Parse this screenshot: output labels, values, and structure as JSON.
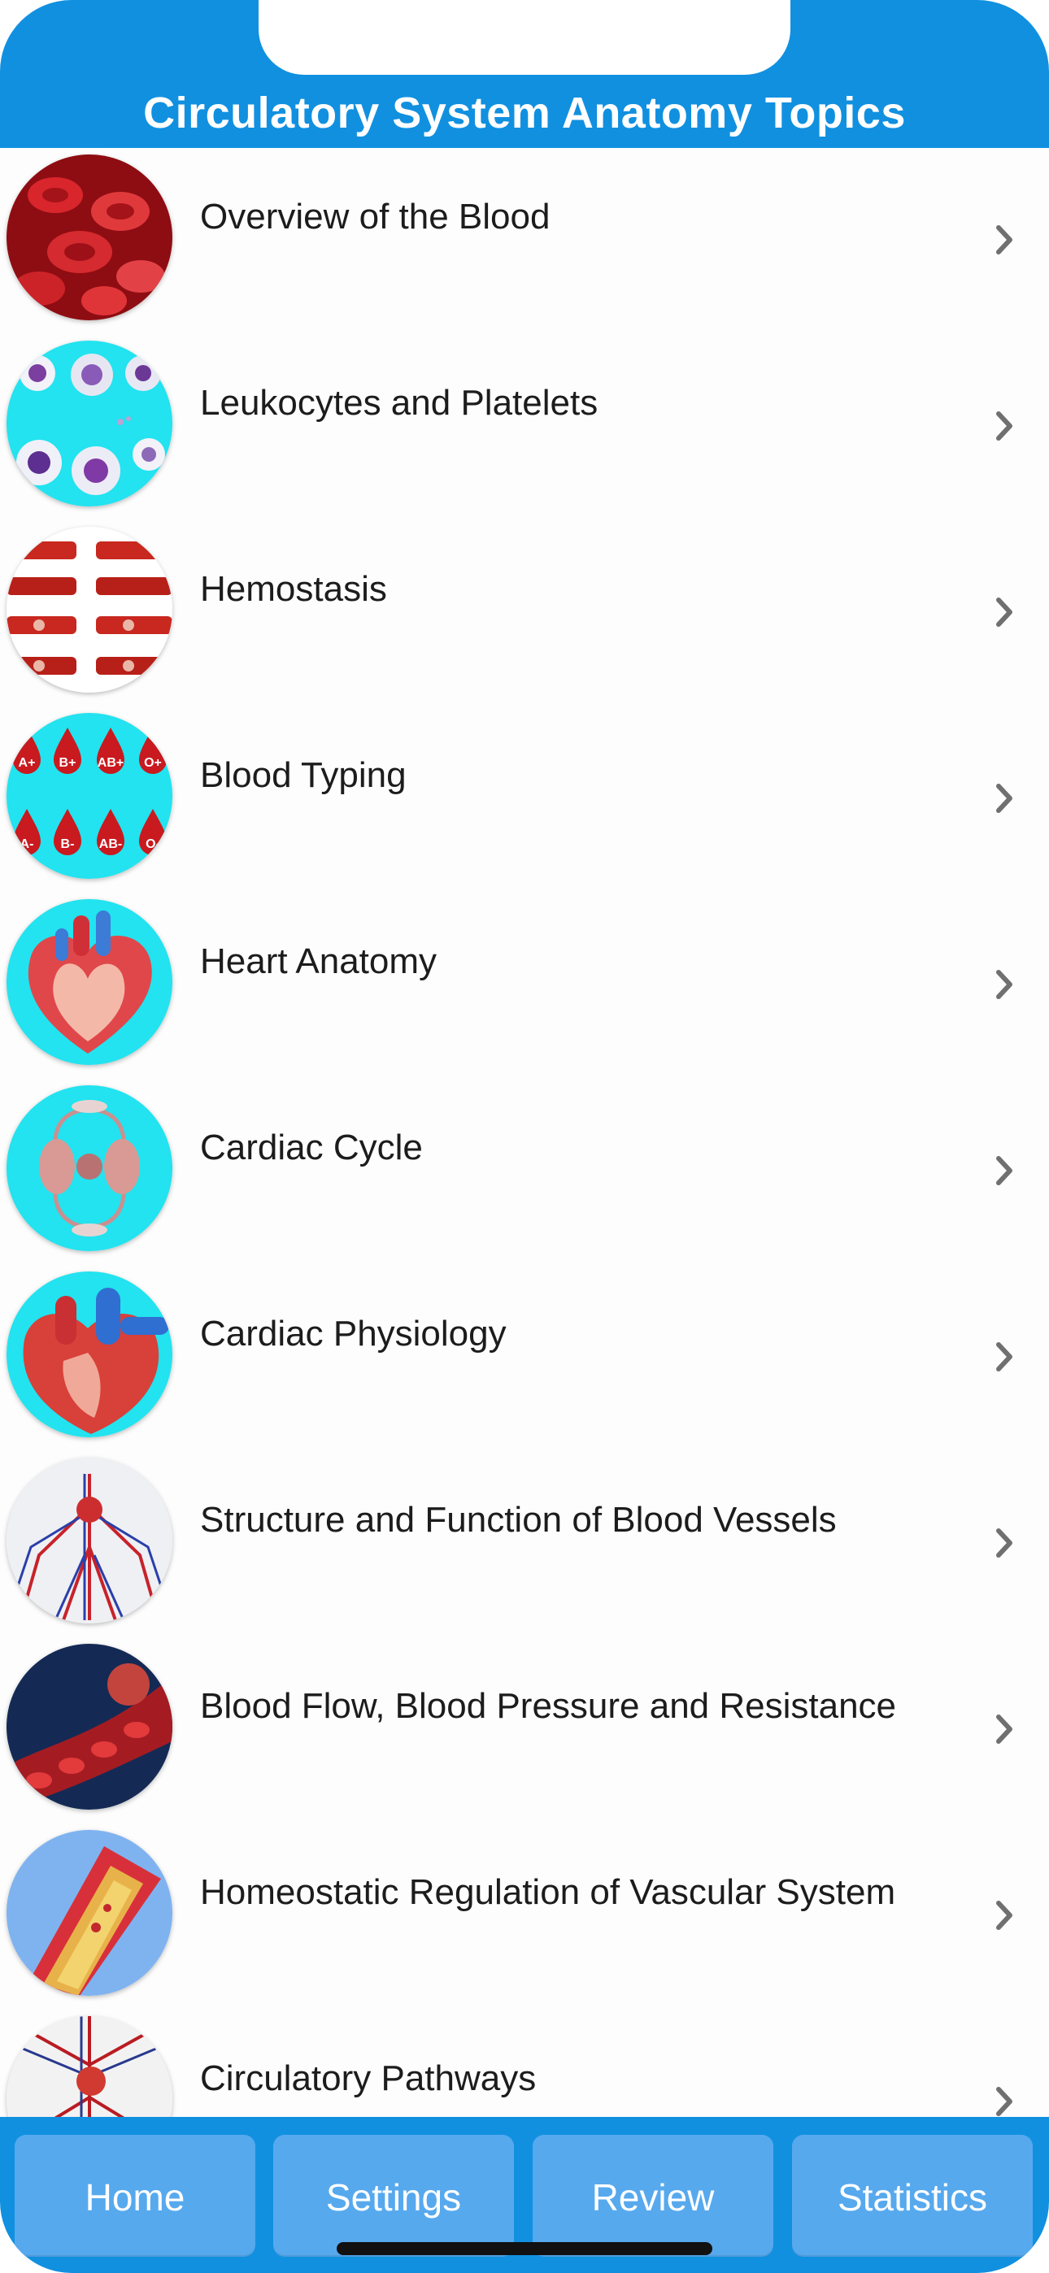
{
  "header": {
    "title": "Circulatory System Anatomy Topics",
    "color": "#1190e0"
  },
  "topics": [
    {
      "label": "Overview of the Blood",
      "icon": "red-blood-cells-icon"
    },
    {
      "label": "Leukocytes and Platelets",
      "icon": "white-blood-cells-icon"
    },
    {
      "label": "Hemostasis",
      "icon": "hemostasis-vessels-icon"
    },
    {
      "label": "Blood Typing",
      "icon": "blood-type-drops-icon"
    },
    {
      "label": "Heart Anatomy",
      "icon": "heart-anatomy-icon"
    },
    {
      "label": "Cardiac Cycle",
      "icon": "cardiac-cycle-icon"
    },
    {
      "label": "Cardiac Physiology",
      "icon": "cardiac-physiology-icon"
    },
    {
      "label": "Structure and Function of Blood Vessels",
      "icon": "blood-vessels-icon"
    },
    {
      "label": "Blood Flow, Blood Pressure and Resistance",
      "icon": "blood-flow-icon"
    },
    {
      "label": "Homeostatic Regulation of Vascular System",
      "icon": "artery-section-icon"
    },
    {
      "label": "Circulatory Pathways",
      "icon": "circulatory-pathways-icon"
    }
  ],
  "tabs": {
    "home": "Home",
    "settings": "Settings",
    "review": "Review",
    "statistics": "Statistics"
  },
  "blood_type_labels": [
    "A+",
    "B+",
    "AB+",
    "O+",
    "A-",
    "B-",
    "AB-",
    "O-"
  ]
}
